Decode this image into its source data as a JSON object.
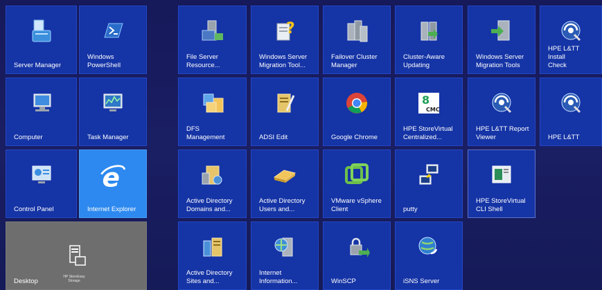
{
  "tiles": [
    {
      "label": "Server Manager",
      "icon": "server-manager-icon"
    },
    {
      "label": "Windows\nPowerShell",
      "icon": "powershell-icon"
    },
    {
      "label": "File Server\nResource...",
      "icon": "file-server-icon"
    },
    {
      "label": "Windows Server\nMigration Tool...",
      "icon": "migration-help-icon"
    },
    {
      "label": "Failover Cluster\nManager",
      "icon": "failover-cluster-icon"
    },
    {
      "label": "Cluster-Aware\nUpdating",
      "icon": "cluster-updating-icon"
    },
    {
      "label": "Windows Server\nMigration Tools",
      "icon": "migration-tools-icon"
    },
    {
      "label": "HPE L&TT Install\nCheck",
      "icon": "ltt-install-icon"
    },
    {
      "label": "Computer",
      "icon": "computer-icon"
    },
    {
      "label": "Task Manager",
      "icon": "task-manager-icon"
    },
    {
      "label": "DFS\nManagement",
      "icon": "dfs-icon"
    },
    {
      "label": "ADSI Edit",
      "icon": "adsi-edit-icon"
    },
    {
      "label": "Google Chrome",
      "icon": "chrome-icon"
    },
    {
      "label": "HPE StoreVirtual\nCentralized...",
      "icon": "cmc-icon"
    },
    {
      "label": "HPE L&TT Report\nViewer",
      "icon": "ltt-report-icon"
    },
    {
      "label": "HPE L&TT",
      "icon": "ltt-icon"
    },
    {
      "label": "Control Panel",
      "icon": "control-panel-icon"
    },
    {
      "label": "Internet Explorer",
      "icon": "ie-icon"
    },
    {
      "label": "Active Directory\nDomains and...",
      "icon": "ad-domains-icon"
    },
    {
      "label": "Active Directory\nUsers and...",
      "icon": "ad-users-icon"
    },
    {
      "label": "VMware vSphere\nClient",
      "icon": "vsphere-icon"
    },
    {
      "label": "putty",
      "icon": "putty-icon"
    },
    {
      "label": "HPE StoreVirtual\nCLI Shell",
      "icon": "cli-shell-icon"
    },
    {
      "label": "Desktop",
      "icon": "storeeasy-icon"
    },
    {
      "label": "Active Directory\nSites and...",
      "icon": "ad-sites-icon"
    },
    {
      "label": "Internet\nInformation...",
      "icon": "iis-icon"
    },
    {
      "label": "WinSCP",
      "icon": "winscp-icon"
    },
    {
      "label": "iSNS Server",
      "icon": "isns-icon"
    }
  ],
  "desktop_sub_label": "HP StoreEasy Storage",
  "cmc_text": "CMC",
  "colors": {
    "background": "#1b1f5e",
    "tile": "#1534a6",
    "ie_tile": "#2d89ef",
    "desktop_tile": "#6e6e6e"
  }
}
